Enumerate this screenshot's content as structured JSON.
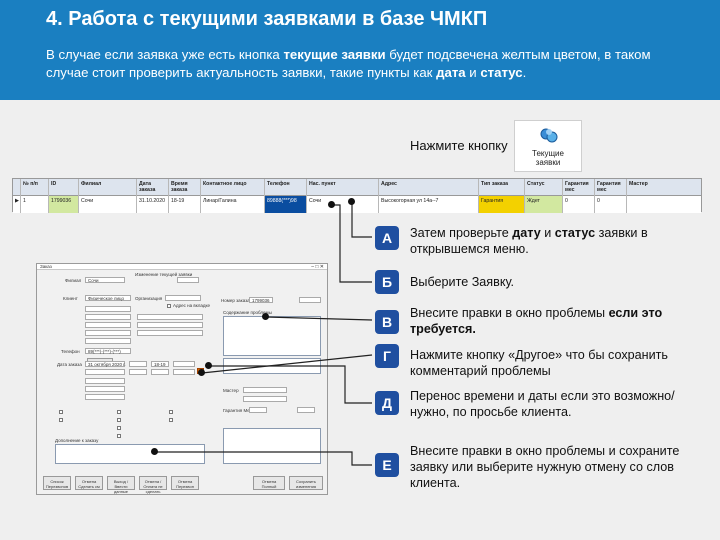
{
  "header": {
    "title": "4. Работа с текущими заявками в базе ЧМКП",
    "intro_1": "В случае если заявка уже есть кнопка ",
    "intro_2": "текущие заявки",
    "intro_3": " будет подсвечена желтым цветом, в таком случае стоит проверить актуальность заявки, такие пункты как ",
    "intro_4": "дата",
    "intro_5": " и ",
    "intro_6": "статус",
    "intro_7": "."
  },
  "press_label": "Нажмите кнопку",
  "current_button": {
    "label_1": "Текущие",
    "label_2": "заявки",
    "icon": "gear-group-icon"
  },
  "table": {
    "headers": [
      "№ п/п",
      "ID",
      "Филиал",
      "Дата заказа",
      "Время заказа",
      "Контактное лицо",
      "Телефон",
      "Нас. пункт",
      "Адрес",
      "Тип заказа",
      "Статус",
      "Гарантия мес",
      "Гарантия мес",
      "Мастер"
    ],
    "row": [
      "1",
      "1799036",
      "Сочи",
      "31.10.2020",
      "18-19",
      "Линар/Галина",
      "89888(***)98",
      "Сочи",
      "Высокогорная ул 14а--7",
      "Гарантия",
      "Ждет",
      "0",
      "0",
      ""
    ]
  },
  "form": {
    "title_left": "Заказ",
    "title_center": "Изменение текущей заявки",
    "filial_label": "Филиал",
    "filial_value": "Сочи",
    "client_label": "Клиент",
    "client_value": "Физическое лицо",
    "organization_label": "Организация",
    "addr_in_label": "Адрес на вкладке",
    "phone_label": "Телефон",
    "phone_value": "89(***)-(***)-(***)",
    "problems_label": "Содержание проблемы",
    "order_number_label": "Номер заказа",
    "order_number_value": "1799036",
    "date_label": "Дата заказа",
    "date_value": "31 октября 2020 г.",
    "time_value": "18-19",
    "master_label": "Мастер",
    "warranty_label": "Гарантия Мес",
    "comment_label": "Дополнение к заказу",
    "buttons": [
      "Список Перезвонов",
      "Отмена Сделать см",
      "Выход / Ввести данные",
      "Отмена / Оплата не сделать",
      "Отмена Перезвон",
      "Отмена Полный",
      "Сохранить изменения"
    ]
  },
  "steps": [
    {
      "letter": "А",
      "text_1": "Затем проверьте ",
      "b1": "дату",
      "text_2": " и ",
      "b2": "статус",
      "text_3": " заявки в открывшемся меню."
    },
    {
      "letter": "Б",
      "text": "Выберите Заявку."
    },
    {
      "letter": "В",
      "text_1": "Внесите правки в окно проблемы ",
      "b1": "если это требуется."
    },
    {
      "letter": "Г",
      "text": "Нажмите кнопку «Другое» что бы сохранить комментарий проблемы"
    },
    {
      "letter": "Д",
      "text": "Перенос времени и даты если это возможно/нужно, по просьбе клиента."
    },
    {
      "letter": "Е",
      "text": "Внесите правки в окно проблемы и сохраните заявку или выберите нужную отмену со слов клиента."
    }
  ],
  "colors": {
    "header_bg": "#1a7fc1",
    "step_bg": "#1f4fa0",
    "highlight_yellow": "#f3d100",
    "selected_blue": "#0a4da0"
  }
}
